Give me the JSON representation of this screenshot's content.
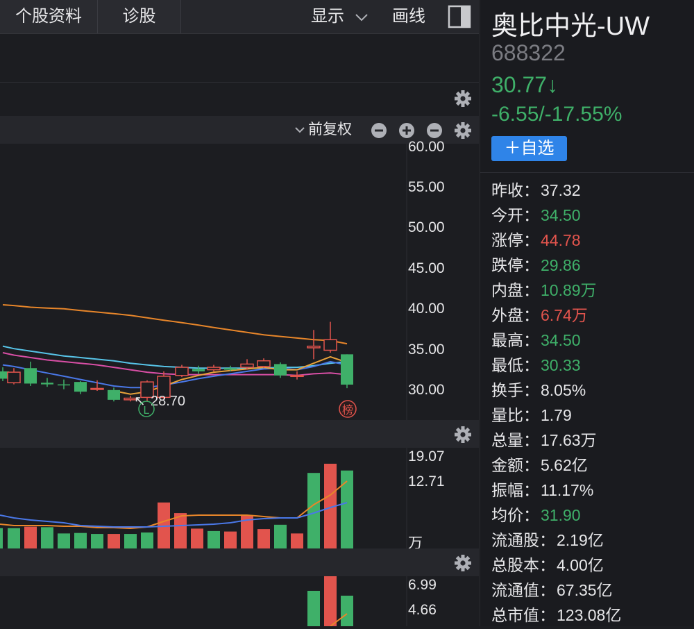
{
  "toolbar": {
    "tab_profile": "个股资料",
    "tab_diagnosis": "诊股",
    "display_label": "显示",
    "draw_label": "画线"
  },
  "kline": {
    "adjust_label": "前复权",
    "low_marker": "28.70",
    "low_badge": "L",
    "rank_badge": "榜",
    "y_labels": [
      "60.00",
      "55.00",
      "50.00",
      "45.00",
      "40.00",
      "35.00",
      "30.00"
    ]
  },
  "volume": {
    "y_labels": [
      "19.07",
      "12.71"
    ],
    "unit": "万"
  },
  "indicator": {
    "y_labels": [
      "6.99",
      "4.66"
    ]
  },
  "stock": {
    "name": "奥比中光-UW",
    "code": "688322",
    "price": "30.77↓",
    "change": "-6.55/-17.55%",
    "add_button": "＋自选"
  },
  "stats": [
    {
      "label": "昨收：",
      "value": "37.32",
      "color": "white"
    },
    {
      "label": "今开：",
      "value": "34.50",
      "color": "green"
    },
    {
      "label": "涨停：",
      "value": "44.78",
      "color": "red"
    },
    {
      "label": "跌停：",
      "value": "29.86",
      "color": "green"
    },
    {
      "label": "内盘：",
      "value": "10.89万",
      "color": "green"
    },
    {
      "label": "外盘：",
      "value": "6.74万",
      "color": "red"
    },
    {
      "label": "最高：",
      "value": "34.50",
      "color": "green"
    },
    {
      "label": "最低：",
      "value": "30.33",
      "color": "green"
    },
    {
      "label": "换手：",
      "value": "8.05%",
      "color": "white"
    },
    {
      "label": "量比：",
      "value": "1.79",
      "color": "white"
    },
    {
      "label": "总量：",
      "value": "17.63万",
      "color": "white"
    },
    {
      "label": "金额：",
      "value": "5.62亿",
      "color": "white"
    },
    {
      "label": "振幅：",
      "value": "11.17%",
      "color": "white"
    },
    {
      "label": "均价：",
      "value": "31.90",
      "color": "green"
    },
    {
      "label": "流通股：",
      "value": "2.19亿",
      "color": "white"
    },
    {
      "label": "总股本：",
      "value": "4.00亿",
      "color": "white"
    },
    {
      "label": "流通值：",
      "value": "67.35亿",
      "color": "white"
    },
    {
      "label": "总市值：",
      "value": "123.08亿",
      "color": "white"
    }
  ],
  "colors": {
    "up": "#e2544d",
    "down": "#3fb069",
    "accent": "#2f84e8",
    "ma_orange": "#e8862a",
    "ma_pink": "#d94fa6",
    "ma_cyan": "#57c4e8",
    "ma_blue": "#4a78e8"
  },
  "chart_data": {
    "type": "candlestick",
    "note": "visible daily K-line, oldest to newest",
    "candles": [
      {
        "o": 32.4,
        "c": 31.5,
        "h": 32.9,
        "l": 31.2
      },
      {
        "o": 31.0,
        "c": 32.3,
        "h": 32.8,
        "l": 30.8
      },
      {
        "o": 32.8,
        "c": 30.9,
        "h": 33.6,
        "l": 30.6
      },
      {
        "o": 31.0,
        "c": 30.8,
        "h": 31.6,
        "l": 30.5
      },
      {
        "o": 30.8,
        "c": 30.7,
        "h": 31.4,
        "l": 30.2
      },
      {
        "o": 31.1,
        "c": 29.9,
        "h": 31.2,
        "l": 29.6
      },
      {
        "o": 30.2,
        "c": 30.3,
        "h": 31.3,
        "l": 30.0
      },
      {
        "o": 30.1,
        "c": 28.9,
        "h": 30.4,
        "l": 28.7
      },
      {
        "o": 28.9,
        "c": 29.1,
        "h": 29.4,
        "l": 28.7
      },
      {
        "o": 29.2,
        "c": 31.1,
        "h": 31.3,
        "l": 28.7
      },
      {
        "o": 29.2,
        "c": 31.8,
        "h": 32.4,
        "l": 29.0
      },
      {
        "o": 31.9,
        "c": 32.9,
        "h": 33.2,
        "l": 31.7
      },
      {
        "o": 32.7,
        "c": 32.4,
        "h": 33.1,
        "l": 32.1
      },
      {
        "o": 32.6,
        "c": 32.9,
        "h": 33.2,
        "l": 32.4
      },
      {
        "o": 32.8,
        "c": 32.6,
        "h": 33.1,
        "l": 32.4
      },
      {
        "o": 32.9,
        "c": 33.3,
        "h": 33.9,
        "l": 32.6
      },
      {
        "o": 33.0,
        "c": 33.7,
        "h": 34.0,
        "l": 32.8
      },
      {
        "o": 33.3,
        "c": 31.9,
        "h": 33.5,
        "l": 31.6
      },
      {
        "o": 31.8,
        "c": 31.9,
        "h": 32.4,
        "l": 31.4
      },
      {
        "o": 35.3,
        "c": 35.5,
        "h": 37.5,
        "l": 33.9
      },
      {
        "o": 35.0,
        "c": 36.3,
        "h": 38.5,
        "l": 34.7
      },
      {
        "o": 34.5,
        "c": 30.77,
        "h": 34.5,
        "l": 30.33
      }
    ],
    "volumes": [
      {
        "v": 4.2,
        "up": false
      },
      {
        "v": 4.5,
        "up": true
      },
      {
        "v": 4.4,
        "up": false
      },
      {
        "v": 3.1,
        "up": false
      },
      {
        "v": 3.2,
        "up": false
      },
      {
        "v": 3.0,
        "up": false
      },
      {
        "v": 3.0,
        "up": true
      },
      {
        "v": 3.0,
        "up": false
      },
      {
        "v": 3.3,
        "up": false
      },
      {
        "v": 9.5,
        "up": true
      },
      {
        "v": 7.3,
        "up": true
      },
      {
        "v": 4.1,
        "up": true
      },
      {
        "v": 3.6,
        "up": false
      },
      {
        "v": 3.5,
        "up": true
      },
      {
        "v": 6.8,
        "up": true
      },
      {
        "v": 4.0,
        "up": true
      },
      {
        "v": 4.9,
        "up": false
      },
      {
        "v": 3.1,
        "up": true
      },
      {
        "v": 15.6,
        "up": false
      },
      {
        "v": 17.5,
        "up": true
      },
      {
        "v": 16.1,
        "up": false
      }
    ],
    "ylim_price": [
      26.5,
      60.0
    ],
    "ylim_volume": [
      0,
      19.07
    ]
  }
}
